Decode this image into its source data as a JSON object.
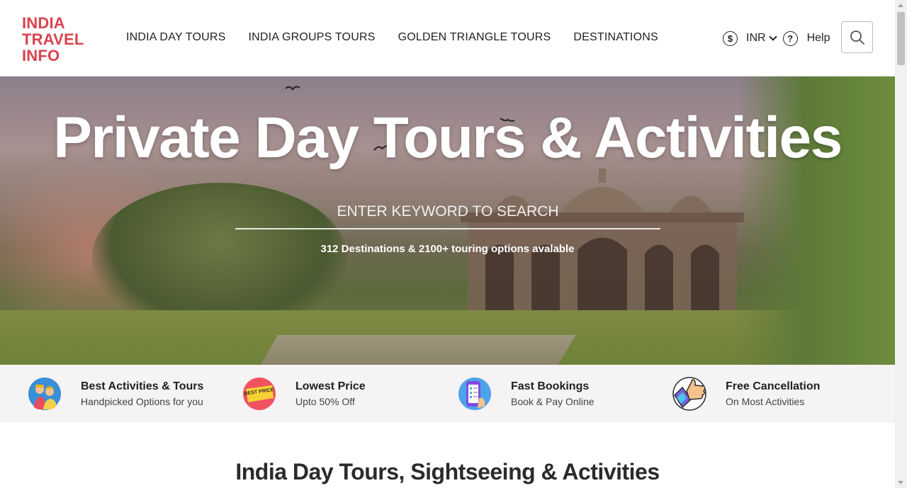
{
  "header": {
    "logo_lines": [
      "INDIA",
      "TRAVEL",
      "INFO"
    ],
    "nav": [
      {
        "label": "INDIA DAY TOURS"
      },
      {
        "label": "INDIA GROUPS TOURS"
      },
      {
        "label": "GOLDEN TRIANGLE TOURS"
      },
      {
        "label": "DESTINATIONS"
      }
    ],
    "currency": "INR",
    "help_label": "Help",
    "icons": {
      "currency": "dollar-circle-icon",
      "help": "question-circle-icon",
      "search": "search-icon"
    }
  },
  "hero": {
    "title": "Private Day Tours & Activities",
    "search_placeholder": "ENTER KEYWORD TO SEARCH",
    "subtitle": "312 Destinations & 2100+ touring options avalable"
  },
  "features": [
    {
      "title": "Best Activities & Tours",
      "desc": "Handpicked Options for you",
      "icon": "travelers-icon"
    },
    {
      "title": "Lowest Price",
      "desc": "Upto 50% Off",
      "icon": "best-price-badge-icon",
      "badge_text": "BEST PRICE"
    },
    {
      "title": "Fast Bookings",
      "desc": "Book & Pay Online",
      "icon": "phone-booking-icon"
    },
    {
      "title": "Free Cancellation",
      "desc": "On Most Activities",
      "icon": "thumbs-up-icon"
    }
  ],
  "section": {
    "title": "India Day Tours, Sightseeing & Activities"
  },
  "colors": {
    "brand": "#d9434e",
    "features_bg": "#f5f3f4"
  }
}
